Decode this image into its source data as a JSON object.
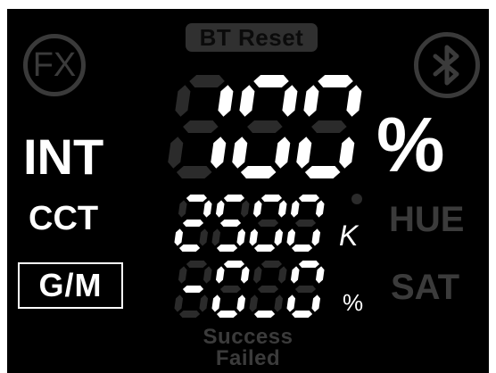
{
  "header": {
    "bt_reset_label": "BT Reset",
    "fx_label": "FX"
  },
  "icons": {
    "fx": "fx-icon",
    "bluetooth": "bluetooth-icon"
  },
  "modes": {
    "int_label": "INT",
    "cct_label": "CCT",
    "gm_label": "G/M",
    "hue_label": "HUE",
    "sat_label": "SAT"
  },
  "intensity": {
    "value": "100",
    "unit": "%"
  },
  "cct": {
    "value": "2500",
    "unit": "K"
  },
  "gm": {
    "value": "-0_0",
    "unit": "%"
  },
  "status": {
    "success_label": "Success",
    "failed_label": "Failed"
  },
  "colors": {
    "background": "#000000",
    "lit": "#ffffff",
    "ghost": "#2b2b2b",
    "dim_text": "#3b3b3b",
    "bt_reset_bg": "#303030",
    "bt_reset_text": "#0b0b0b"
  }
}
